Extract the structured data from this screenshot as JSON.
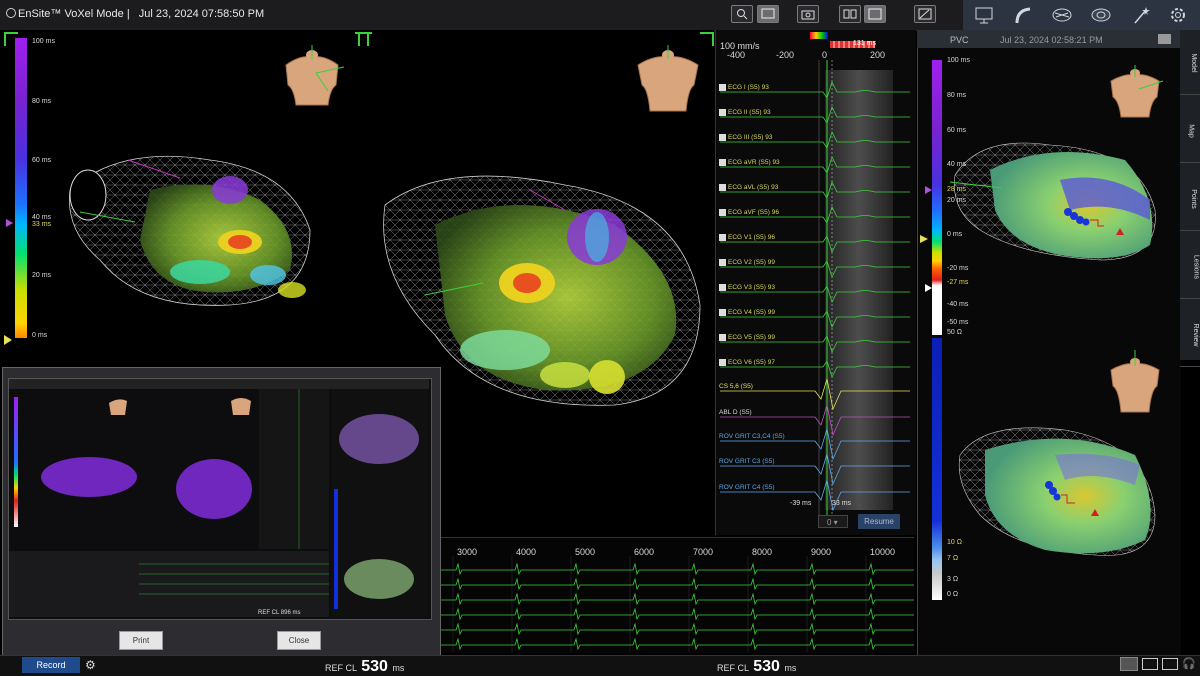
{
  "app": {
    "name": "EnSite™ VoXel Mode |",
    "datetime": "Jul 23, 2024 07:58:50 PM"
  },
  "toolbar": {
    "icons": [
      "search-icon",
      "screen-icon",
      "camera-icon",
      "dual-view-icon",
      "fullscreen-icon",
      "tools-icon"
    ]
  },
  "nav": {
    "icons": [
      "monitor-icon",
      "catheter-icon",
      "heart-map-icon",
      "heart-icon",
      "lesion-icon",
      "settings-icon"
    ]
  },
  "scale_main": {
    "ticks": [
      "100 ms",
      "80 ms",
      "60 ms",
      "40 ms",
      "33 ms",
      "20 ms",
      "0 ms"
    ]
  },
  "ecg": {
    "speed": "100 mm/s",
    "axis": [
      "-400",
      "-200",
      "0",
      "200"
    ],
    "window_label": "131 ms",
    "leads": [
      {
        "name": "ECG I (S5)",
        "val": "93"
      },
      {
        "name": "ECG II (S5)",
        "val": "93"
      },
      {
        "name": "ECG III (S5)",
        "val": "93"
      },
      {
        "name": "ECG aVR (S5)",
        "val": "93"
      },
      {
        "name": "ECG aVL (S5)",
        "val": "93"
      },
      {
        "name": "ECG aVF (S5)",
        "val": "96"
      },
      {
        "name": "ECG V1 (S5)",
        "val": "96"
      },
      {
        "name": "ECG V2 (S5)",
        "val": "99"
      },
      {
        "name": "ECG V3 (S5)",
        "val": "93"
      },
      {
        "name": "ECG V4 (S5)",
        "val": "99"
      },
      {
        "name": "ECG V5 (S5)",
        "val": "99"
      },
      {
        "name": "ECG V6 (S5)",
        "val": "97"
      }
    ],
    "other": [
      "CS 5,6 (S5)",
      "ABL D (S5)",
      "ROV GRIT C3,C4 (S5)",
      "ROV GRIT C3 (S5)",
      "ROV GRIT C4 (S5)"
    ],
    "marker_left": "-39 ms",
    "marker_right": "33 ms",
    "counter": "0",
    "resume": "Resume"
  },
  "right": {
    "title": "PVC",
    "datetime": "Jul 23, 2024 02:58:21 PM",
    "tabs": [
      "Model",
      "Map",
      "Points",
      "Lesions",
      "Review"
    ],
    "scale_ticks": [
      "100 ms",
      "80 ms",
      "60 ms",
      "40 ms",
      "28 ms",
      "20 ms",
      "0 ms",
      "-20 ms",
      "-27 ms",
      "-40 ms",
      "-50 ms"
    ],
    "imp_ticks": [
      "50 Ω",
      "10 Ω",
      "7 Ω",
      "3 Ω",
      "0 Ω"
    ]
  },
  "strip": {
    "axis": [
      "3000",
      "4000",
      "5000",
      "6000",
      "7000",
      "8000",
      "9000",
      "10000"
    ]
  },
  "dialog": {
    "print": "Print",
    "close": "Close",
    "thumb_ref": "REF CL 896 ms",
    "thumb_ref2": "REF CL 896 ms"
  },
  "bottom": {
    "record": "Record",
    "ref_label": "REF",
    "cl_label": "CL",
    "cl_value_1": "530",
    "cl_value_2": "530",
    "unit": "ms"
  }
}
